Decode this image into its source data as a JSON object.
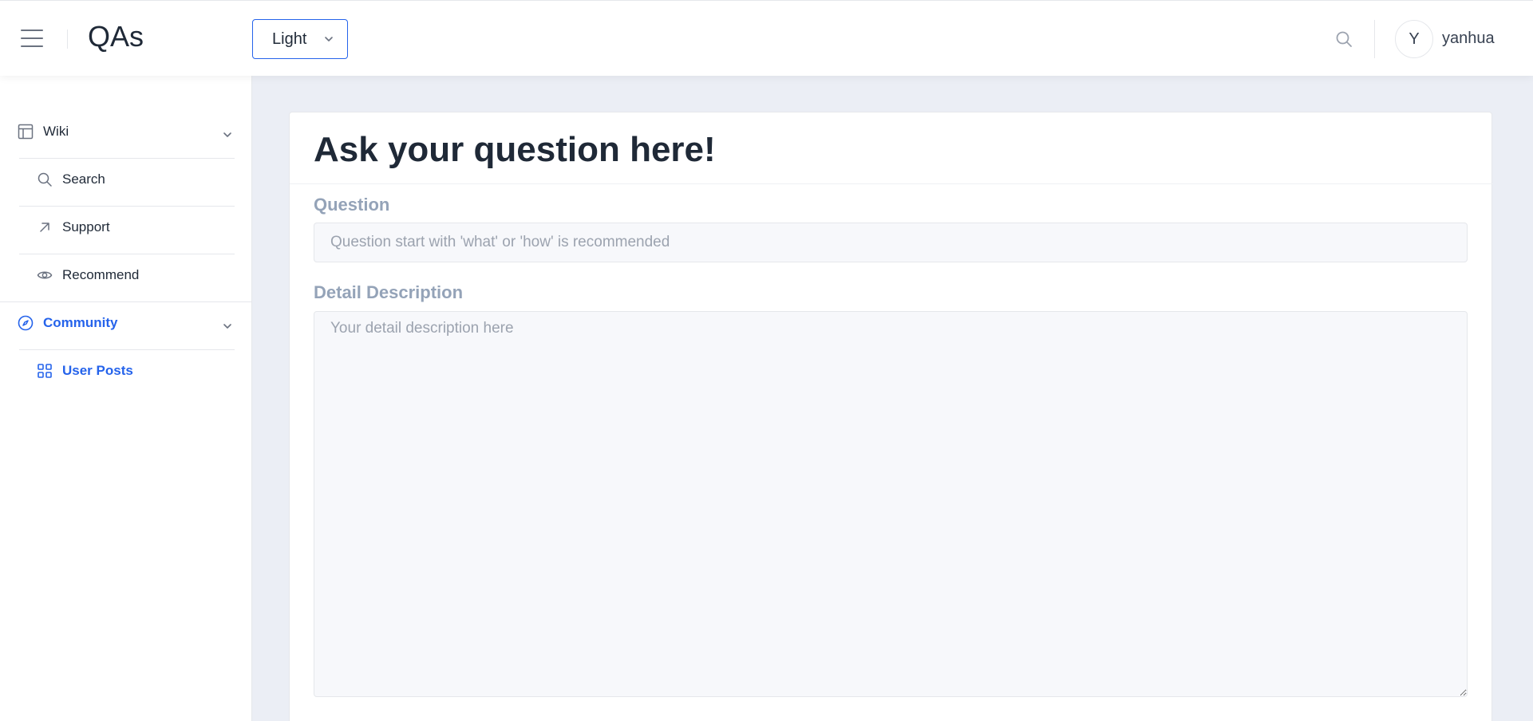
{
  "header": {
    "brand": "QAs",
    "theme_value": "Light",
    "avatar_initial": "Y",
    "username": "yanhua"
  },
  "sidebar": {
    "groups": [
      {
        "label": "Wiki",
        "icon": "layout-icon",
        "items": [
          {
            "label": "Search",
            "icon": "search-icon"
          },
          {
            "label": "Support",
            "icon": "arrow-up-right-icon"
          },
          {
            "label": "Recommend",
            "icon": "eye-icon"
          }
        ]
      },
      {
        "label": "Community",
        "icon": "compass-icon",
        "active": true,
        "items": [
          {
            "label": "User Posts",
            "icon": "grid-icon",
            "active": true
          }
        ]
      }
    ]
  },
  "form": {
    "title": "Ask your question here!",
    "question_label": "Question",
    "question_placeholder": "Question start with 'what' or 'how' is recommended",
    "question_value": "",
    "description_label": "Detail Description",
    "description_placeholder": "Your detail description here",
    "description_value": ""
  },
  "colors": {
    "accent": "#2563eb",
    "background": "#ebeef5",
    "label_muted": "#94a3b8"
  }
}
